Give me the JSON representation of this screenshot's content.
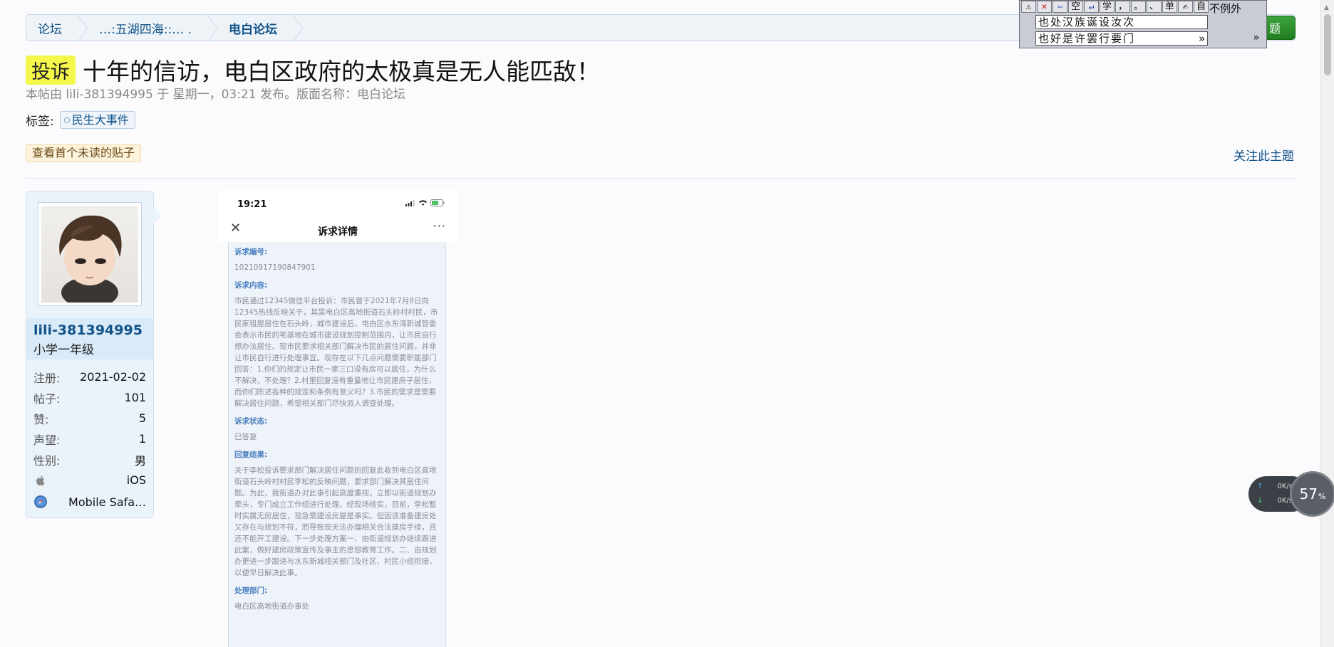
{
  "breadcrumb": {
    "items": [
      "论坛",
      "…:五湖四海::… .",
      "电白论坛"
    ]
  },
  "toolbar": {
    "new_topic_label": "题"
  },
  "ime": {
    "toolbar_glyphs": [
      "⚠",
      "✕",
      "⇦",
      "空",
      "↵",
      "学",
      "，",
      "。",
      "、",
      "单",
      "✍",
      "自"
    ],
    "right_text": "不例外",
    "row1": "也处汉族诞设汝次",
    "row2": "也好是许罢行要门",
    "more": "»",
    "scroll": "»"
  },
  "topic": {
    "badge": "投诉",
    "title": "十年的信访，电白区政府的太极真是无人能匹敌！",
    "meta": "本帖由 lili-381394995 于 星期一，03:21 发布。版面名称：电白论坛"
  },
  "tags": {
    "label": "标签:",
    "items": [
      "民生大事件"
    ]
  },
  "actions": {
    "unread": "查看首个未读的贴子",
    "follow": "关注此主题"
  },
  "author": {
    "username": "lili-381394995",
    "rank": "小学一年级",
    "stats": [
      {
        "label": "注册:",
        "value": "2021-02-02"
      },
      {
        "label": "帖子:",
        "value": "101"
      },
      {
        "label": "赞:",
        "value": "5"
      },
      {
        "label": "声望:",
        "value": "1"
      },
      {
        "label": "性别:",
        "value": "男"
      }
    ],
    "os": "iOS",
    "browser": "Mobile Safa…"
  },
  "screenshot": {
    "time": "19:21",
    "nav_title": "诉求详情",
    "close": "✕",
    "more": "···",
    "sections": [
      {
        "head": "诉求编号:",
        "text": "10210917190847901"
      },
      {
        "head": "诉求内容:",
        "text": "市民通过12345微信平台投诉：市民曾于2021年7月8日向12345热线反映关于，其是电白区高地街道石头岭村村民，市民家租屋居住在石头岭，城市建设后，电白区水东湾新城管委会表示市民的宅基地在城市建设规划控制范围内，让市民自行想办法居住。现市民要求相关部门解决市民的居住问题，并非让市民自行进行处理事宜。现存在以下几点问题需要职能部门回答：1.你们的规定让市民一家三口没有房可以居住，为什么不解决，不处理？2.村里回复没有重量地让市民建房子居住，而你们陈述各种的规定和条例有意义吗？3.市民的需求是需要解决居住问题，希望相关部门尽快派人调查处理。"
      },
      {
        "head": "诉求状态:",
        "text": "已答复"
      },
      {
        "head": "回复结果:",
        "text": "关于李松投诉要求部门解决居住问题的回复此收到电白区高地街道石头岭村村民李松的反映问题，要求部门解决其居住问题。为此，我街道办对此事引起高度重视，立即以街道规划办牵头，专门成立工作组进行处理。经现场核实，目前，李松暂时实属无房居住，现急需建设房屋是事实。但因该准备建房处又存在与规划不符，而导致现无法办理相关合法建房手续，且还不能开工建设。下一步处理方案一、由街道规划办继续跟进此案，做好建房政策宣传及事主的思想教育工作。二、由规划办更进一步跟进与水东新城相关部门及社区、村民小组衔接，以便早日解决此事。"
      },
      {
        "head": "处理部门:",
        "text": "电白区高地街道办事处"
      }
    ]
  },
  "speed": {
    "up": "0K/s",
    "down": "0K/s",
    "percent": "57",
    "percent_unit": "%"
  },
  "colors": {
    "link": "#105289",
    "badge": "#f5f74a",
    "button": "#1f7d1f"
  }
}
